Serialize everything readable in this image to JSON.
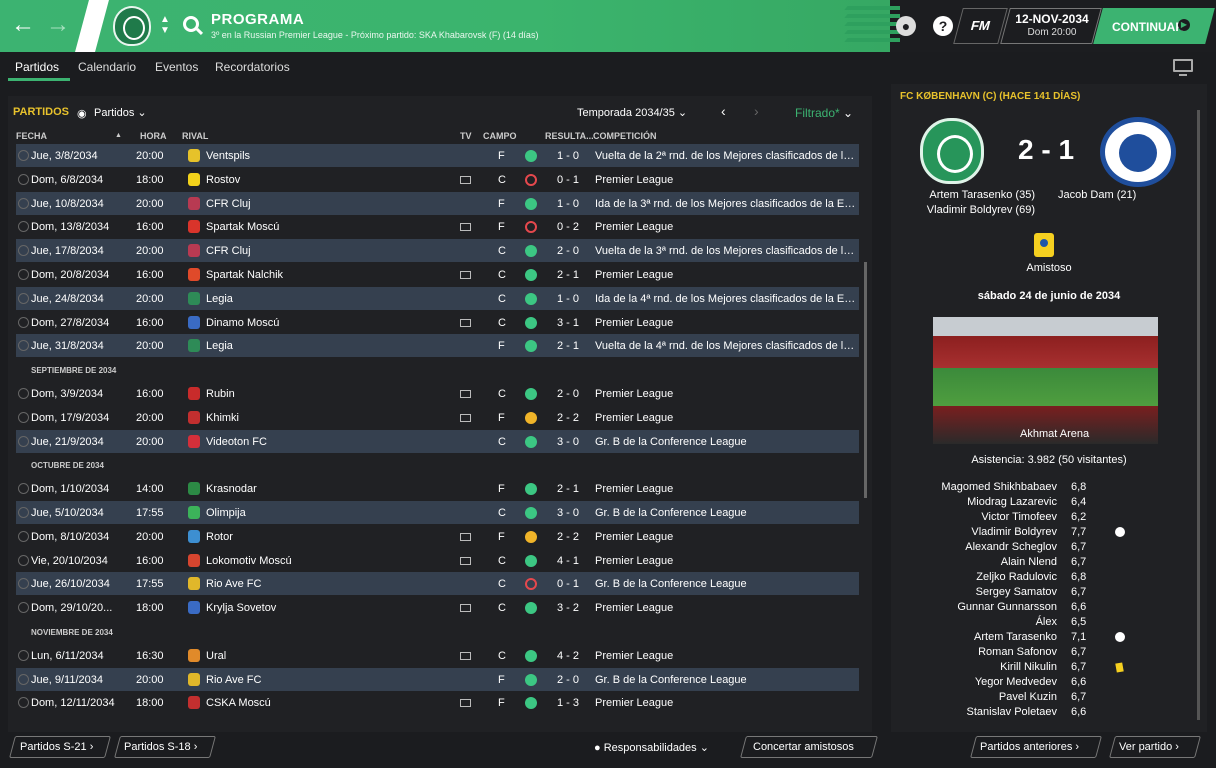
{
  "header": {
    "title": "PROGRAMA",
    "subtitle": "3º en la Russian Premier League - Próximo partido: SKA Khabarovsk (F)  (14 días)",
    "date": "12-NOV-2034",
    "time": "Dom 20:00",
    "fm_label": "FM",
    "help": "?",
    "continue_label": "CONTINUAR"
  },
  "tabs": [
    "Partidos",
    "Calendario",
    "Eventos",
    "Recordatorios"
  ],
  "list": {
    "title": "PARTIDOS",
    "dropdown": "Partidos",
    "season": "Temporada 2034/35",
    "filter": "Filtrado*",
    "columns": {
      "fecha": "FECHA",
      "hora": "HORA",
      "rival": "RIVAL",
      "tv": "TV",
      "campo": "CAMPO",
      "resultado": "RESULTA...",
      "competicion": "COMPETICIÓN"
    }
  },
  "rows": [
    {
      "fecha": "Jue, 3/8/2034",
      "hora": "20:00",
      "rival": "Ventspils",
      "tv": false,
      "campo": "F",
      "res": "w",
      "score": "1 - 0",
      "comp": "Vuelta de la 2ª rnd. de los Mejores clasificados de la Europa League",
      "hl": true,
      "badge": "#e6c22a"
    },
    {
      "fecha": "Dom, 6/8/2034",
      "hora": "18:00",
      "rival": "Rostov",
      "tv": true,
      "campo": "C",
      "res": "l",
      "score": "0 - 1",
      "comp": "Premier League",
      "hl": false,
      "badge": "#f2d21b"
    },
    {
      "fecha": "Jue, 10/8/2034",
      "hora": "20:00",
      "rival": "CFR Cluj",
      "tv": false,
      "campo": "F",
      "res": "w",
      "score": "1 - 0",
      "comp": "Ida de la 3ª rnd. de los Mejores clasificados de la Europa League",
      "hl": true,
      "badge": "#b83a52"
    },
    {
      "fecha": "Dom, 13/8/2034",
      "hora": "16:00",
      "rival": "Spartak Moscú",
      "tv": true,
      "campo": "F",
      "res": "l",
      "score": "0 - 2",
      "comp": "Premier League",
      "hl": false,
      "badge": "#d9342b"
    },
    {
      "fecha": "Jue, 17/8/2034",
      "hora": "20:00",
      "rival": "CFR Cluj",
      "tv": false,
      "campo": "C",
      "res": "w",
      "score": "2 - 0",
      "comp": "Vuelta de la 3ª rnd. de los Mejores clasificados de la Europa League",
      "hl": true,
      "badge": "#b83a52"
    },
    {
      "fecha": "Dom, 20/8/2034",
      "hora": "16:00",
      "rival": "Spartak Nalchik",
      "tv": true,
      "campo": "C",
      "res": "w",
      "score": "2 - 1",
      "comp": "Premier League",
      "hl": false,
      "badge": "#e04a2a"
    },
    {
      "fecha": "Jue, 24/8/2034",
      "hora": "20:00",
      "rival": "Legia",
      "tv": false,
      "campo": "C",
      "res": "w",
      "score": "1 - 0",
      "comp": "Ida de la 4ª rnd. de los Mejores clasificados de la Europa League",
      "hl": true,
      "badge": "#2e8b57"
    },
    {
      "fecha": "Dom, 27/8/2034",
      "hora": "16:00",
      "rival": "Dinamo Moscú",
      "tv": true,
      "campo": "C",
      "res": "w",
      "score": "3 - 1",
      "comp": "Premier League",
      "hl": false,
      "badge": "#3a6bc4"
    },
    {
      "fecha": "Jue, 31/8/2034",
      "hora": "20:00",
      "rival": "Legia",
      "tv": false,
      "campo": "F",
      "res": "w",
      "score": "2 - 1",
      "comp": "Vuelta de la 4ª rnd. de los Mejores clasificados de la Europa League",
      "hl": true,
      "badge": "#2e8b57"
    },
    {
      "section": "SEPTIEMBRE DE 2034"
    },
    {
      "fecha": "Dom, 3/9/2034",
      "hora": "16:00",
      "rival": "Rubin",
      "tv": true,
      "campo": "C",
      "res": "w",
      "score": "2 - 0",
      "comp": "Premier League",
      "hl": false,
      "badge": "#c82b2b"
    },
    {
      "fecha": "Dom, 17/9/2034",
      "hora": "20:00",
      "rival": "Khimki",
      "tv": true,
      "campo": "F",
      "res": "d",
      "score": "2 - 2",
      "comp": "Premier League",
      "hl": false,
      "badge": "#c22f2f"
    },
    {
      "fecha": "Jue, 21/9/2034",
      "hora": "20:00",
      "rival": "Videoton FC",
      "tv": false,
      "campo": "C",
      "res": "w",
      "score": "3 - 0",
      "comp": "Gr. B de la Conference League",
      "hl": true,
      "badge": "#d32f3a"
    },
    {
      "section": "OCTUBRE DE 2034"
    },
    {
      "fecha": "Dom, 1/10/2034",
      "hora": "14:00",
      "rival": "Krasnodar",
      "tv": false,
      "campo": "F",
      "res": "w",
      "score": "2 - 1",
      "comp": "Premier League",
      "hl": false,
      "badge": "#2c8a45"
    },
    {
      "fecha": "Jue, 5/10/2034",
      "hora": "17:55",
      "rival": "Olimpija",
      "tv": false,
      "campo": "C",
      "res": "w",
      "score": "3 - 0",
      "comp": "Gr. B de la Conference League",
      "hl": true,
      "badge": "#3cb35a"
    },
    {
      "fecha": "Dom, 8/10/2034",
      "hora": "20:00",
      "rival": "Rotor",
      "tv": true,
      "campo": "F",
      "res": "d",
      "score": "2 - 2",
      "comp": "Premier League",
      "hl": false,
      "badge": "#3d8fd1"
    },
    {
      "fecha": "Vie, 20/10/2034",
      "hora": "16:00",
      "rival": "Lokomotiv Moscú",
      "tv": true,
      "campo": "C",
      "res": "w",
      "score": "4 - 1",
      "comp": "Premier League",
      "hl": false,
      "badge": "#d6452f"
    },
    {
      "fecha": "Jue, 26/10/2034",
      "hora": "17:55",
      "rival": "Rio Ave FC",
      "tv": false,
      "campo": "C",
      "res": "l",
      "score": "0 - 1",
      "comp": "Gr. B de la Conference League",
      "hl": true,
      "badge": "#e0b72a"
    },
    {
      "fecha": "Dom, 29/10/20...",
      "hora": "18:00",
      "rival": "Krylja Sovetov",
      "tv": true,
      "campo": "C",
      "res": "w",
      "score": "3 - 2",
      "comp": "Premier League",
      "hl": false,
      "badge": "#3a6bc4"
    },
    {
      "section": "NOVIEMBRE DE 2034"
    },
    {
      "fecha": "Lun, 6/11/2034",
      "hora": "16:30",
      "rival": "Ural",
      "tv": true,
      "campo": "C",
      "res": "w",
      "score": "4 - 2",
      "comp": "Premier League",
      "hl": false,
      "badge": "#e08a2a"
    },
    {
      "fecha": "Jue, 9/11/2034",
      "hora": "20:00",
      "rival": "Rio Ave FC",
      "tv": false,
      "campo": "F",
      "res": "w",
      "score": "2 - 0",
      "comp": "Gr. B de la Conference League",
      "hl": true,
      "badge": "#e0b72a"
    },
    {
      "fecha": "Dom, 12/11/2034",
      "hora": "18:00",
      "rival": "CSKA Moscú",
      "tv": true,
      "campo": "F",
      "res": "w",
      "score": "1 - 3",
      "comp": "Premier League",
      "hl": false,
      "badge": "#c22f2f"
    }
  ],
  "bottom": {
    "s21": "Partidos S-21",
    "s18": "Partidos S-18",
    "responsabilidades": "Responsabilidades",
    "amistosos": "Concertar amistosos",
    "anteriores": "Partidos anteriores",
    "ver": "Ver partido"
  },
  "match": {
    "title": "FC KØBENHAVN (C)  (HACE 141 DÍAS)",
    "score": "2 - 1",
    "home_scorers": [
      "Artem Tarasenko (35)",
      "Vladimir Boldyrev (69)"
    ],
    "away_scorers": [
      "Jacob Dam (21)"
    ],
    "competition": "Amistoso",
    "date": "sábado 24 de junio de 2034",
    "stadium": "Akhmat Arena",
    "attendance": "Asistencia: 3.982 (50 visitantes)",
    "ratings": [
      {
        "name": "Magomed Shikhbabaev",
        "val": "6,8",
        "icon": ""
      },
      {
        "name": "Miodrag Lazarevic",
        "val": "6,4",
        "icon": ""
      },
      {
        "name": "Victor Timofeev",
        "val": "6,2",
        "icon": ""
      },
      {
        "name": "Vladimir Boldyrev",
        "val": "7,7",
        "icon": "goal"
      },
      {
        "name": "Alexandr Scheglov",
        "val": "6,7",
        "icon": ""
      },
      {
        "name": "Alain Nlend",
        "val": "6,7",
        "icon": ""
      },
      {
        "name": "Zeljko Radulovic",
        "val": "6,8",
        "icon": ""
      },
      {
        "name": "Sergey Samatov",
        "val": "6,7",
        "icon": ""
      },
      {
        "name": "Gunnar Gunnarsson",
        "val": "6,6",
        "icon": ""
      },
      {
        "name": "Álex",
        "val": "6,5",
        "icon": ""
      },
      {
        "name": "Artem Tarasenko",
        "val": "7,1",
        "icon": "goal"
      },
      {
        "name": "Roman Safonov",
        "val": "6,7",
        "icon": ""
      },
      {
        "name": "Kirill Nikulin",
        "val": "6,7",
        "icon": "card"
      },
      {
        "name": "Yegor Medvedev",
        "val": "6,6",
        "icon": ""
      },
      {
        "name": "Pavel Kuzin",
        "val": "6,7",
        "icon": ""
      },
      {
        "name": "Stanislav Poletaev",
        "val": "6,6",
        "icon": ""
      }
    ]
  }
}
